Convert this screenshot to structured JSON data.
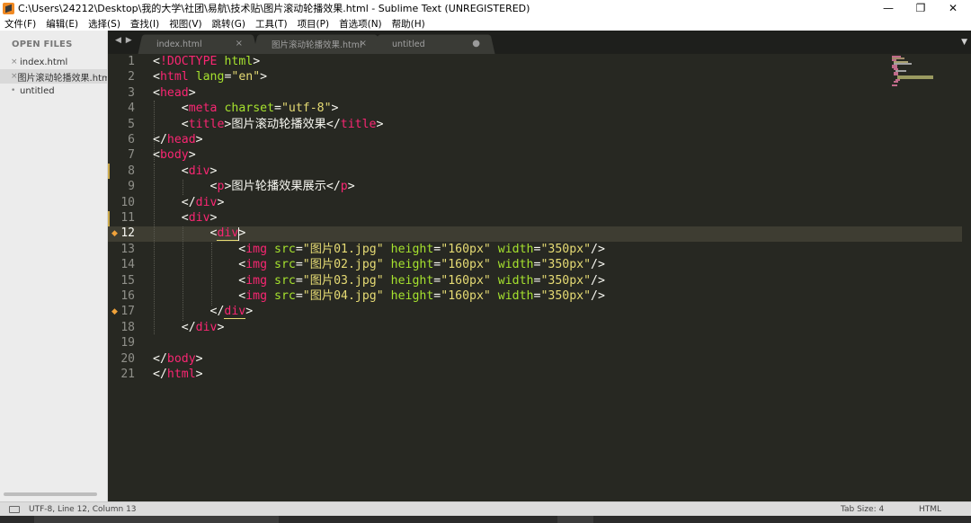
{
  "window": {
    "title": "C:\\Users\\24212\\Desktop\\我的大学\\社团\\易航\\技术贴\\图片滚动轮播效果.html - Sublime Text (UNREGISTERED)",
    "minimize_glyph": "—",
    "restore_glyph": "❐",
    "close_glyph": "✕"
  },
  "menu": [
    "文件(F)",
    "编辑(E)",
    "选择(S)",
    "查找(I)",
    "视图(V)",
    "跳转(G)",
    "工具(T)",
    "项目(P)",
    "首选项(N)",
    "帮助(H)"
  ],
  "sidebar": {
    "header": "OPEN FILES",
    "files": [
      {
        "mark": "×",
        "name": "index.html"
      },
      {
        "mark": "×",
        "name": "图片滚动轮播效果.html"
      },
      {
        "mark": "•",
        "name": "untitled"
      }
    ]
  },
  "tabs": {
    "nav": "◀ ▶",
    "items": [
      {
        "label": "index.html",
        "close": "×"
      },
      {
        "label": "图片滚动轮播效果.html",
        "close": "×"
      },
      {
        "label": "untitled",
        "close": "●"
      }
    ],
    "dropdown": "▼"
  },
  "editor": {
    "line_numbers": [
      "1",
      "2",
      "3",
      "4",
      "5",
      "6",
      "7",
      "8",
      "9",
      "10",
      "11",
      "12",
      "13",
      "14",
      "15",
      "16",
      "17",
      "18",
      "19",
      "20",
      "21"
    ],
    "current_line": 12,
    "code": {
      "l1_lt": "<",
      "l1_doctype": "!DOCTYPE",
      "l1_html": "html",
      "l1_gt": ">",
      "l2_lt": "<",
      "l2_tag": "html",
      "l2_attr": "lang",
      "l2_eq": "=",
      "l2_val": "\"en\"",
      "l2_gt": ">",
      "l3_lt": "<",
      "l3_tag": "head",
      "l3_gt": ">",
      "l4_lt": "<",
      "l4_tag": "meta",
      "l4_attr": "charset",
      "l4_eq": "=",
      "l4_val": "\"utf-8\"",
      "l4_gt": ">",
      "l5_lt": "<",
      "l5_tag": "title",
      "l5_gt": ">",
      "l5_text": "图片滚动轮播效果",
      "l5_close_lt": "</",
      "l5_close_tag": "title",
      "l5_close_gt": ">",
      "l6_lt": "</",
      "l6_tag": "head",
      "l6_gt": ">",
      "l7_lt": "<",
      "l7_tag": "body",
      "l7_gt": ">",
      "l8_lt": "<",
      "l8_tag": "div",
      "l8_gt": ">",
      "l9_lt": "<",
      "l9_tag": "p",
      "l9_gt": ">",
      "l9_text": "图片轮播效果展示",
      "l9_close_lt": "</",
      "l9_close_tag": "p",
      "l9_close_gt": ">",
      "l10_lt": "</",
      "l10_tag": "div",
      "l10_gt": ">",
      "l11_lt": "<",
      "l11_tag": "div",
      "l11_gt": ">",
      "l12_lt": "<",
      "l12_tag": "div",
      "l12_gt": ">",
      "img_lt": "<",
      "img_tag": "img",
      "src_attr": "src",
      "eq": "=",
      "src1": "\"图片01.jpg\"",
      "src2": "\"图片02.jpg\"",
      "src3": "\"图片03.jpg\"",
      "src4": "\"图片04.jpg\"",
      "height_attr": "height",
      "height_val": "\"160px\"",
      "width_attr": "width",
      "width_val": "\"350px\"",
      "img_end": "/>",
      "l17_lt": "</",
      "l17_tag": "div",
      "l17_gt": ">",
      "l18_lt": "</",
      "l18_tag": "div",
      "l18_gt": ">",
      "l20_lt": "</",
      "l20_tag": "body",
      "l20_gt": ">",
      "l21_lt": "</",
      "l21_tag": "html",
      "l21_gt": ">"
    }
  },
  "status": {
    "position": "UTF-8, Line 12, Column 13",
    "tab_size": "Tab Size: 4",
    "syntax": "HTML"
  },
  "colors": {
    "background": "#272822",
    "tag": "#f92672",
    "attribute": "#a6e22e",
    "string": "#e6db74",
    "text": "#f8f8f2",
    "line_number": "#90908a"
  }
}
